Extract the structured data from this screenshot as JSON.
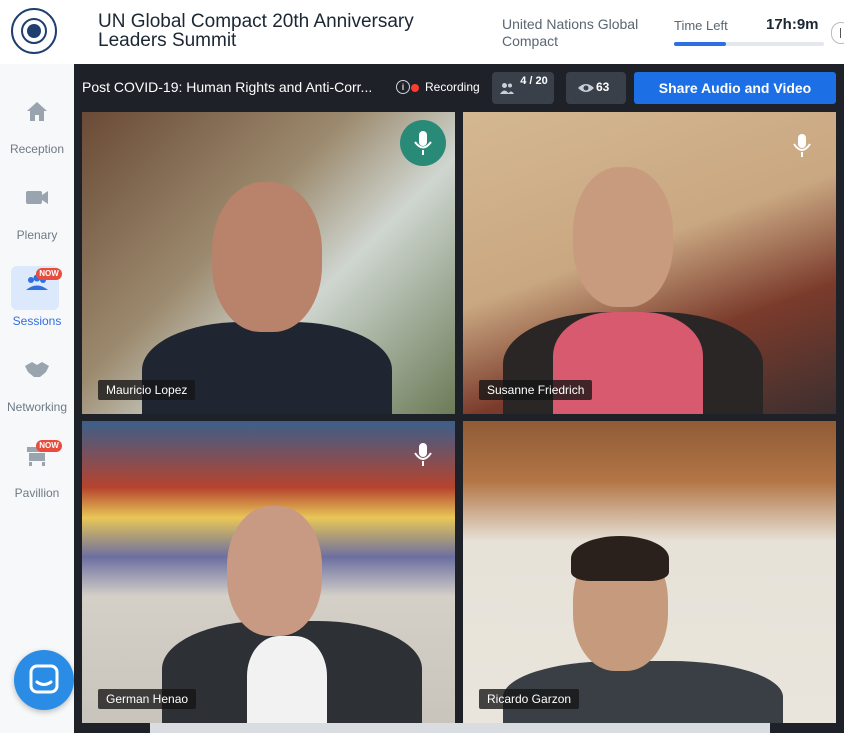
{
  "header": {
    "event_title": "UN Global Compact 20th Anniversary Leaders Summit",
    "organization": "United Nations Global Compact",
    "time_left_label": "Time Left",
    "time_left_value": "17h:9m",
    "logo_icon": "un-global-compact-logo"
  },
  "sidebar": {
    "items": [
      {
        "label": "Reception",
        "icon": "house-icon",
        "badge": ""
      },
      {
        "label": "Plenary",
        "icon": "video-camera-icon",
        "badge": ""
      },
      {
        "label": "Sessions",
        "icon": "people-group-icon",
        "badge": "NOW",
        "active": true
      },
      {
        "label": "Networking",
        "icon": "handshake-icon",
        "badge": ""
      },
      {
        "label": "Pavillion",
        "icon": "booth-icon",
        "badge": "NOW"
      }
    ],
    "chat_icon": "chat-bubble-icon"
  },
  "session": {
    "title": "Post COVID-19: Human Rights and Anti-Corr...",
    "recording_label": "Recording",
    "participants": "4 / 20",
    "views": "63",
    "share_button_label": "Share Audio and Video"
  },
  "participants": [
    {
      "name": "Mauricio Lopez",
      "speaking": true
    },
    {
      "name": "Susanne Friedrich",
      "speaking": false
    },
    {
      "name": "German Henao",
      "speaking": false
    },
    {
      "name": "Ricardo Garzon",
      "speaking": false
    }
  ],
  "colors": {
    "accent": "#1d6fe6",
    "recording": "#ff3b30",
    "now_badge": "#e84c3d",
    "speaking_mic": "#2a8a78"
  }
}
